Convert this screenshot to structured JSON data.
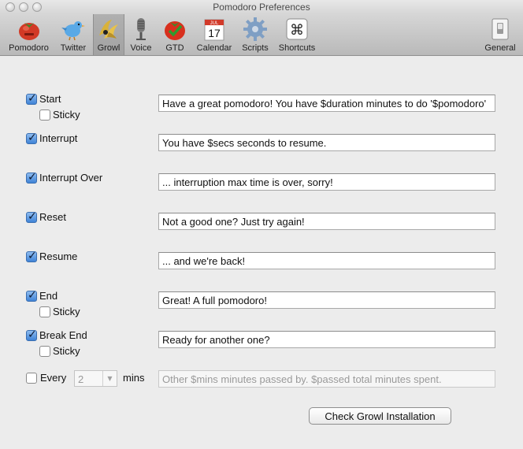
{
  "window": {
    "title": "Pomodoro Preferences"
  },
  "toolbar": {
    "items": [
      {
        "label": "Pomodoro",
        "icon": "tomato-icon"
      },
      {
        "label": "Twitter",
        "icon": "bird-icon"
      },
      {
        "label": "Growl",
        "icon": "growl-claw-icon"
      },
      {
        "label": "Voice",
        "icon": "microphone-icon"
      },
      {
        "label": "GTD",
        "icon": "tomato-check-icon"
      },
      {
        "label": "Calendar",
        "icon": "calendar-icon"
      },
      {
        "label": "Scripts",
        "icon": "gear-icon"
      },
      {
        "label": "Shortcuts",
        "icon": "command-key-icon"
      }
    ],
    "general": {
      "label": "General",
      "icon": "switch-icon"
    },
    "calendar_day": "17",
    "calendar_month": "JUL",
    "shortcut_glyph": "⌘",
    "selected": "Growl"
  },
  "events": [
    {
      "label": "Start",
      "checked": true,
      "sticky_label": "Sticky",
      "sticky": false,
      "message": "Have a great pomodoro! You have $duration minutes to do '$pomodoro'"
    },
    {
      "label": "Interrupt",
      "checked": true,
      "message": "You have $secs seconds to resume."
    },
    {
      "label": "Interrupt Over",
      "checked": true,
      "message": "... interruption max time is over, sorry!"
    },
    {
      "label": "Reset",
      "checked": true,
      "message": "Not a good one? Just try again!"
    },
    {
      "label": "Resume",
      "checked": true,
      "message": "... and we're back!"
    },
    {
      "label": "End",
      "checked": true,
      "sticky_label": "Sticky",
      "sticky": false,
      "message": "Great! A full pomodoro!"
    },
    {
      "label": "Break End",
      "checked": true,
      "sticky_label": "Sticky",
      "sticky": false,
      "message": "Ready for another one?"
    }
  ],
  "every": {
    "label": "Every",
    "checked": false,
    "value": "2",
    "unit": "mins",
    "message": "Other $mins minutes passed by. $passed total minutes spent."
  },
  "check_button": {
    "label": "Check Growl Installation"
  },
  "colors": {
    "accent": "#3f83d6",
    "background": "#ececec"
  }
}
